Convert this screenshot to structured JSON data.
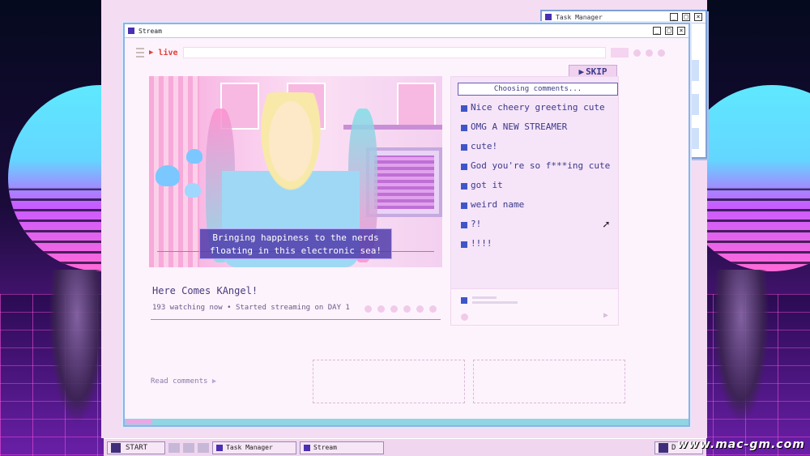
{
  "task_manager": {
    "title": "Task Manager"
  },
  "stream_window": {
    "title": "Stream",
    "live_label": "live",
    "skip_label": "SKIP",
    "subtitle_line1": "Bringing happiness to the nerds",
    "subtitle_line2": "floating in this electronic sea!",
    "stream_name": "Here Comes KAngel!",
    "stream_meta": "193 watching now • Started streaming on DAY 1",
    "read_comments_label": "Read comments"
  },
  "comments": {
    "header": "Choosing comments...",
    "items": [
      "Nice cheery greeting cute",
      "OMG A NEW STREAMER",
      "cute!",
      "God you're so f***ing cute",
      "got it",
      "weird name",
      "?!",
      "!!!!"
    ]
  },
  "taskbar": {
    "start_label": "START",
    "tasks": [
      "Task Manager",
      "Stream"
    ],
    "tray_text": "D"
  },
  "watermark": "www.mac-gm.com",
  "colors": {
    "accent": "#3f56c8",
    "live": "#e0423a",
    "window_border": "#8fb2e4"
  }
}
